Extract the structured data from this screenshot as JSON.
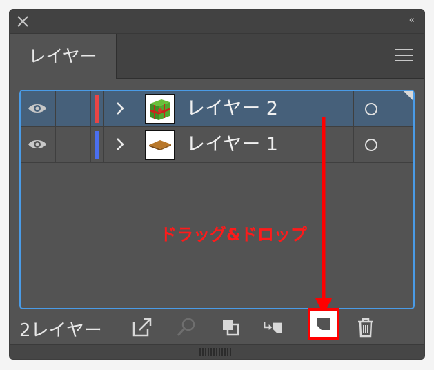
{
  "panel": {
    "tab_label": "レイヤー",
    "collapse_glyph": "‹‹"
  },
  "layers": [
    {
      "name": "レイヤー 2",
      "color": "#e84545",
      "selected": true,
      "icon": "gift-box-thumbnail"
    },
    {
      "name": "レイヤー 1",
      "color": "#4a6ff0",
      "selected": false,
      "icon": "board-thumbnail"
    }
  ],
  "annotation": {
    "label": "ドラッグ&ドロップ",
    "color": "#ff1a1a"
  },
  "footer": {
    "layer_count": "2レイヤー"
  },
  "colors": {
    "selection_border": "#4a9be6",
    "highlight": "#ff0000"
  }
}
